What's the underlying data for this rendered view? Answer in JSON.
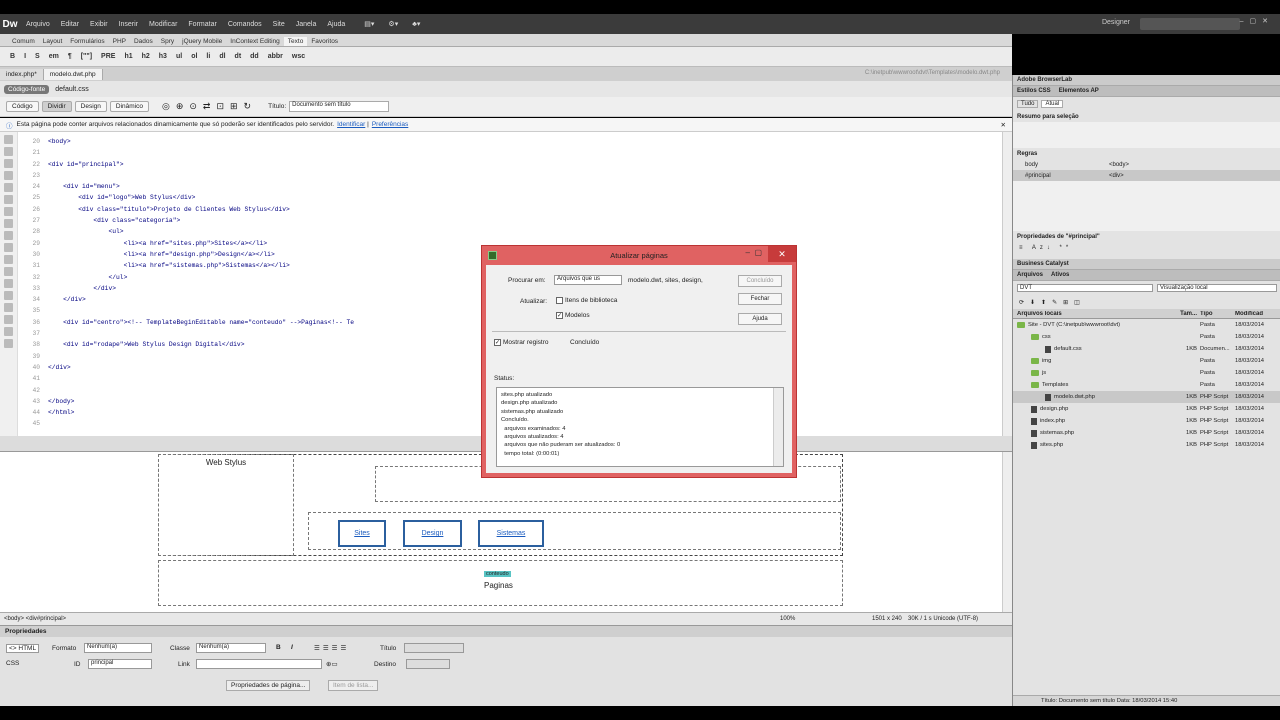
{
  "app": {
    "logo": "Dw",
    "workspace": "Designer"
  },
  "menu": [
    "Arquivo",
    "Editar",
    "Exibir",
    "Inserir",
    "Modificar",
    "Formatar",
    "Comandos",
    "Site",
    "Janela",
    "Ajuda"
  ],
  "insert_tabs": [
    "Comum",
    "Layout",
    "Formulários",
    "PHP",
    "Dados",
    "Spry",
    "jQuery Mobile",
    "InContext Editing",
    "Texto",
    "Favoritos"
  ],
  "text_toolbar": [
    "B",
    "I",
    "S",
    "em",
    "¶",
    "[\"\"]",
    "PRE",
    "h1",
    "h2",
    "h3",
    "ul",
    "ol",
    "li",
    "dl",
    "dt",
    "dd",
    "abbr",
    "wsc"
  ],
  "doc_tabs": [
    "index.php*",
    "modelo.dwt.php"
  ],
  "doc_path": "C:\\inetpub\\wwwroot\\dvt\\Templates\\modelo.dwt.php",
  "related": {
    "source": "Código-fonte",
    "css": "default.css"
  },
  "view": {
    "buttons": [
      "Código",
      "Dividir",
      "Design",
      "Dinâmico"
    ],
    "title_label": "Título:",
    "title_value": "Documento sem título"
  },
  "infobar": {
    "text": "Esta página pode conter arquivos relacionados dinamicamente que só poderão ser identificados pelo servidor.",
    "link1": "Identificar",
    "link2": "Preferências"
  },
  "code_lines": [
    {
      "n": "20",
      "t": "<body>"
    },
    {
      "n": "21",
      "t": ""
    },
    {
      "n": "22",
      "t": "<div id=\"principal\">"
    },
    {
      "n": "23",
      "t": ""
    },
    {
      "n": "24",
      "t": "    <div id=\"menu\">"
    },
    {
      "n": "25",
      "t": "        <div id=\"logo\">Web Stylus</div>"
    },
    {
      "n": "26",
      "t": "        <div class=\"titulo\">Projeto de Clientes Web Stylus</div>"
    },
    {
      "n": "27",
      "t": "            <div class=\"categoria\">"
    },
    {
      "n": "28",
      "t": "                <ul>"
    },
    {
      "n": "29",
      "t": "                    <li><a href=\"sites.php\">Sites</a></li>"
    },
    {
      "n": "30",
      "t": "                    <li><a href=\"design.php\">Design</a></li>"
    },
    {
      "n": "31",
      "t": "                    <li><a href=\"sistemas.php\">Sistemas</a></li>"
    },
    {
      "n": "32",
      "t": "                </ul>"
    },
    {
      "n": "33",
      "t": "            </div>"
    },
    {
      "n": "34",
      "t": "    </div>"
    },
    {
      "n": "35",
      "t": ""
    },
    {
      "n": "36",
      "t": "    <div id=\"centro\"><!-- TemplateBeginEditable name=\"conteudo\" -->Paginas<!-- Te"
    },
    {
      "n": "37",
      "t": ""
    },
    {
      "n": "38",
      "t": "    <div id=\"rodape\">Web Stylus Design Digital</div>"
    },
    {
      "n": "39",
      "t": ""
    },
    {
      "n": "40",
      "t": "</div>"
    },
    {
      "n": "41",
      "t": ""
    },
    {
      "n": "42",
      "t": ""
    },
    {
      "n": "43",
      "t": "</body>"
    },
    {
      "n": "44",
      "t": "</html>"
    },
    {
      "n": "45",
      "t": ""
    }
  ],
  "design": {
    "logo": "Web Stylus",
    "nav": [
      "Sites",
      "Design",
      "Sistemas"
    ],
    "badge": "conteudo",
    "content": "Paginas"
  },
  "statusbar": {
    "path": "<body> <div#principal>",
    "zoom": "100%",
    "size": "1501 x 240",
    "info": "30K / 1 s  Unicode (UTF-8)"
  },
  "properties": {
    "title": "Propriedades",
    "html": "<> HTML",
    "css": "CSS",
    "format_label": "Formato",
    "format_value": "Nenhum(a)",
    "id_label": "ID",
    "id_value": "principal",
    "class_label": "Classe",
    "class_value": "Nenhum(a)",
    "link_label": "Link",
    "title_label": "Título",
    "target_label": "Destino",
    "page_props": "Propriedades de página...",
    "list_item": "Item de lista..."
  },
  "right_panel": {
    "browserlab": "Adobe BrowserLab",
    "css_tabs": [
      "Estilos CSS",
      "Elementos AP"
    ],
    "css_modes": [
      "Tudo",
      "Atual"
    ],
    "summary": "Resumo para seleção",
    "rules_title": "Regras",
    "rules": [
      {
        "a": "body",
        "b": "<body>"
      },
      {
        "a": "#principal",
        "b": "<div>"
      }
    ],
    "props_title": "Propriedades de \"#principal\"",
    "catalyst": "Business Catalyst",
    "files_tabs": [
      "Arquivos",
      "Ativos"
    ],
    "site_select": "DVT",
    "view_select": "Visualização local",
    "files_cols": [
      "Arquivos locais",
      "Tam...",
      "Tipo",
      "Modificad"
    ],
    "files": [
      {
        "name": "Site - DVT (C:\\inetpub\\wwwroot\\dvt)",
        "size": "",
        "type": "Pasta",
        "mod": "18/03/2014",
        "ind": 0,
        "icon": "folder"
      },
      {
        "name": "css",
        "size": "",
        "type": "Pasta",
        "mod": "18/03/2014",
        "ind": 1,
        "icon": "folder"
      },
      {
        "name": "default.css",
        "size": "1KB",
        "type": "Documen...",
        "mod": "18/03/2014",
        "ind": 2,
        "icon": "doc"
      },
      {
        "name": "img",
        "size": "",
        "type": "Pasta",
        "mod": "18/03/2014",
        "ind": 1,
        "icon": "folder"
      },
      {
        "name": "js",
        "size": "",
        "type": "Pasta",
        "mod": "18/03/2014",
        "ind": 1,
        "icon": "folder"
      },
      {
        "name": "Templates",
        "size": "",
        "type": "Pasta",
        "mod": "18/03/2014",
        "ind": 1,
        "icon": "folder"
      },
      {
        "name": "modelo.dwt.php",
        "size": "1KB",
        "type": "PHP Script",
        "mod": "18/03/2014",
        "ind": 2,
        "icon": "doc"
      },
      {
        "name": "design.php",
        "size": "1KB",
        "type": "PHP Script",
        "mod": "18/03/2014",
        "ind": 1,
        "icon": "doc"
      },
      {
        "name": "index.php",
        "size": "1KB",
        "type": "PHP Script",
        "mod": "18/03/2014",
        "ind": 1,
        "icon": "doc"
      },
      {
        "name": "sistemas.php",
        "size": "1KB",
        "type": "PHP Script",
        "mod": "18/03/2014",
        "ind": 1,
        "icon": "doc"
      },
      {
        "name": "sites.php",
        "size": "1KB",
        "type": "PHP Script",
        "mod": "18/03/2014",
        "ind": 1,
        "icon": "doc"
      }
    ],
    "status": "Título: Documento sem título  Data: 18/03/2014 15:40"
  },
  "dialog": {
    "title": "Atualizar páginas",
    "search_label": "Procurar em:",
    "search_value": "Arquivos que us",
    "search_files": "modelo.dwt, sites, design,",
    "update_label": "Atualizar:",
    "opt_library": "Itens de biblioteca",
    "opt_templates": "Modelos",
    "btn_done": "Concluído",
    "btn_close": "Fechar",
    "btn_help": "Ajuda",
    "show_log": "Mostrar registro",
    "state": "Concluído",
    "status_label": "Status:",
    "log": [
      "sites.php atualizado",
      "design.php atualizado",
      "sistemas.php atualizado",
      "Concluído.",
      "  arquivos examinados: 4",
      "  arquivos atualizados: 4",
      "  arquivos que não puderam ser atualizados: 0",
      "  tempo total: (0:00:01)"
    ]
  }
}
